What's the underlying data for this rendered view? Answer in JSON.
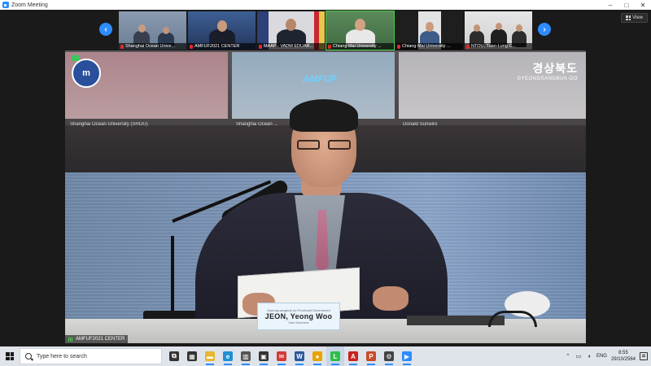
{
  "window": {
    "title": "Zoom Meeting",
    "controls": [
      "–",
      "□",
      "✕"
    ]
  },
  "toolbar": {
    "view_label": "View"
  },
  "filmstrip": {
    "prev_arrow": "‹",
    "next_arrow": "›",
    "participants": [
      {
        "name": "Shanghai Ocean Unive...",
        "muted": true
      },
      {
        "name": "AMFUF2021 CENTER",
        "muted": true
      },
      {
        "name": "MAAP - VADM EDUAR...",
        "muted": true
      },
      {
        "name": "Chiang Mai University ...",
        "muted": true
      },
      {
        "name": "Chiang Mai University ...",
        "muted": true
      },
      {
        "name": "NTOU, Tuan-Lung C...",
        "muted": true
      }
    ]
  },
  "main_video": {
    "participant_label": "AMFUF2021 CENTER",
    "wall_logo_text": "AMFUF",
    "emblem_text": "m",
    "sponsor_korean": "경상북도",
    "sponsor_english": "GYEONGSANGBUK-DO",
    "wall_labels": [
      "Shanghai Ocean University (SHOU)",
      "Shanghai Ocean ...",
      "Donald Suriwiro"
    ],
    "nameplate": {
      "top": "Gyeong-sangbuk-do Provincial Government",
      "name": "JEON, Yeong Woo",
      "sub": "Vice Governor"
    }
  },
  "taskbar": {
    "search_placeholder": "Type here to search",
    "apps": [
      {
        "icon": "task-view-icon",
        "glyph": "⧉",
        "color": "#333333"
      },
      {
        "icon": "widgets-icon",
        "glyph": "▦",
        "color": "#333333"
      },
      {
        "icon": "file-explorer-icon",
        "glyph": "▬",
        "color": "#e8b730"
      },
      {
        "icon": "edge-icon",
        "glyph": "e",
        "color": "#1f8fd6"
      },
      {
        "icon": "calendar-icon",
        "glyph": "▥",
        "color": "#555555"
      },
      {
        "icon": "store-icon",
        "glyph": "▣",
        "color": "#333333"
      },
      {
        "icon": "mail-icon",
        "glyph": "✉",
        "color": "#d23a3a"
      },
      {
        "icon": "word-icon",
        "glyph": "W",
        "color": "#2b579a"
      },
      {
        "icon": "chrome-icon",
        "glyph": "●",
        "color": "#e8a400"
      },
      {
        "icon": "line-icon",
        "glyph": "L",
        "color": "#2fbf49"
      },
      {
        "icon": "acrobat-icon",
        "glyph": "A",
        "color": "#c8231f"
      },
      {
        "icon": "powerpoint-icon",
        "glyph": "P",
        "color": "#c84b2a"
      },
      {
        "icon": "settings-icon",
        "glyph": "⚙",
        "color": "#444444"
      },
      {
        "icon": "zoom-app-icon",
        "glyph": "▶",
        "color": "#2d8cff"
      }
    ],
    "tray_language": "ENG",
    "time": "8:55",
    "date": "29/10/2564"
  }
}
